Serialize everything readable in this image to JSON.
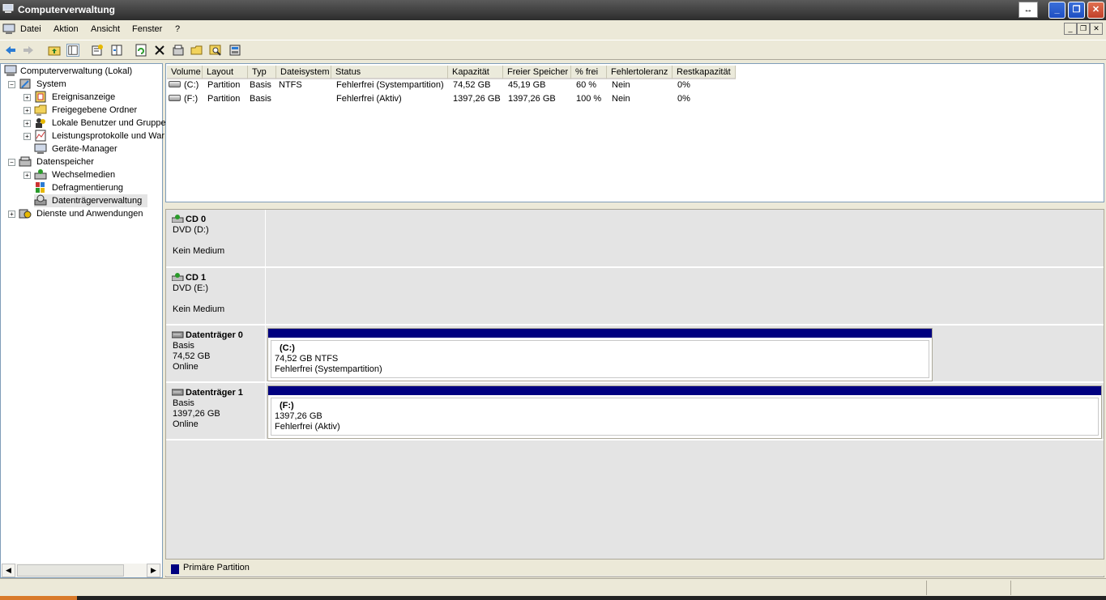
{
  "window": {
    "title": "Computerverwaltung"
  },
  "menu": [
    "Datei",
    "Aktion",
    "Ansicht",
    "Fenster",
    "?"
  ],
  "toolbar_icons": [
    "back-icon",
    "forward-icon",
    "up-folder-icon",
    "show-hide-tree-icon",
    "properties-icon",
    "export-list-icon",
    "refresh-icon",
    "delete-icon",
    "disk-properties-icon",
    "open-icon",
    "search-icon",
    "help-icon"
  ],
  "tree": {
    "root": "Computerverwaltung (Lokal)",
    "system": "System",
    "ereignis": "Ereignisanzeige",
    "freigegeben": "Freigegebene Ordner",
    "benutzer": "Lokale Benutzer und Gruppe",
    "leistung": "Leistungsprotokolle und War",
    "geraete": "Geräte-Manager",
    "datenspeicher": "Datenspeicher",
    "wechsel": "Wechselmedien",
    "defrag": "Defragmentierung",
    "datentraeger": "Datenträgerverwaltung",
    "dienste": "Dienste und Anwendungen"
  },
  "volume_table": {
    "columns": [
      "Volume",
      "Layout",
      "Typ",
      "Dateisystem",
      "Status",
      "Kapazität",
      "Freier Speicher",
      "% frei",
      "Fehlertoleranz",
      "Restkapazität"
    ],
    "rows": [
      [
        "(C:)",
        "Partition",
        "Basis",
        "NTFS",
        "Fehlerfrei (Systempartition)",
        "74,52 GB",
        "45,19 GB",
        "60 %",
        "Nein",
        "0%"
      ],
      [
        "(F:)",
        "Partition",
        "Basis",
        "",
        "Fehlerfrei (Aktiv)",
        "1397,26 GB",
        "1397,26 GB",
        "100 %",
        "Nein",
        "0%"
      ]
    ]
  },
  "disks": {
    "cd0": {
      "name": "CD 0",
      "type": "DVD (D:)",
      "media": "Kein Medium"
    },
    "cd1": {
      "name": "CD 1",
      "type": "DVD (E:)",
      "media": "Kein Medium"
    },
    "disk0": {
      "name": "Datenträger 0",
      "kind": "Basis",
      "size": "74,52 GB",
      "state": "Online",
      "partition": {
        "label": "(C:)",
        "info": "74,52 GB NTFS",
        "status": "Fehlerfrei (Systempartition)"
      }
    },
    "disk1": {
      "name": "Datenträger 1",
      "kind": "Basis",
      "size": "1397,26 GB",
      "state": "Online",
      "partition": {
        "label": "(F:)",
        "info": "1397,26 GB",
        "status": "Fehlerfrei (Aktiv)"
      }
    }
  },
  "legend": {
    "primary": "Primäre Partition",
    "color": "#000080"
  },
  "colors": {
    "partition_bar": "#000080",
    "title_close": "#d6503a"
  }
}
